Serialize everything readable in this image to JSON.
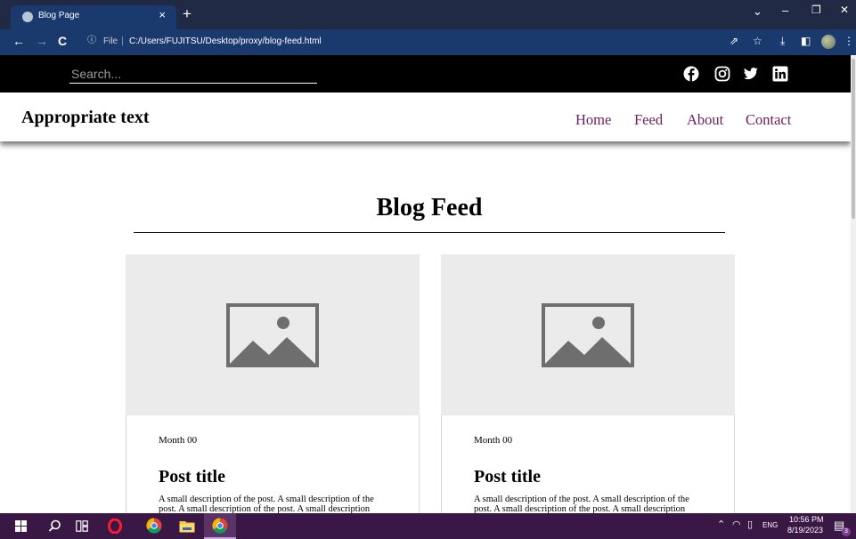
{
  "browser": {
    "tab_title": "Blog Page",
    "tab_close": "×",
    "new_tab": "+",
    "url_prefix": "File",
    "url": "C:/Users/FUJITSU/Desktop/proxy/blog-feed.html",
    "window_controls": {
      "minimize": "–",
      "restore": "❐",
      "close": "✕",
      "tab_search": "⌄"
    }
  },
  "topbar": {
    "search": {
      "placeholder": "Search...",
      "value": ""
    },
    "social_icons": [
      "facebook-icon",
      "instagram-icon",
      "twitter-icon",
      "linkedin-icon"
    ]
  },
  "navbar": {
    "brand": "Appropriate text",
    "links": [
      "Home",
      "Feed",
      "About",
      "Contact"
    ]
  },
  "main": {
    "title": "Blog Feed",
    "posts": [
      {
        "date": "Month 00",
        "title": "Post title",
        "description": "A small description of the post. A small description of the post. A small description of the post. A small description"
      },
      {
        "date": "Month 00",
        "title": "Post title",
        "description": "A small description of the post. A small description of the post. A small description of the post. A small description"
      }
    ]
  },
  "taskbar": {
    "time": "10:56 PM",
    "date": "8/19/2023",
    "language": "ENG",
    "notification_count": "3"
  },
  "colors": {
    "titlebar": "#202a44",
    "toolbar": "#1a3a6e",
    "topbar": "#000000",
    "nav_link": "#6a1f5e",
    "card_image_bg": "#ebebeb",
    "taskbar": "#3a1846"
  }
}
